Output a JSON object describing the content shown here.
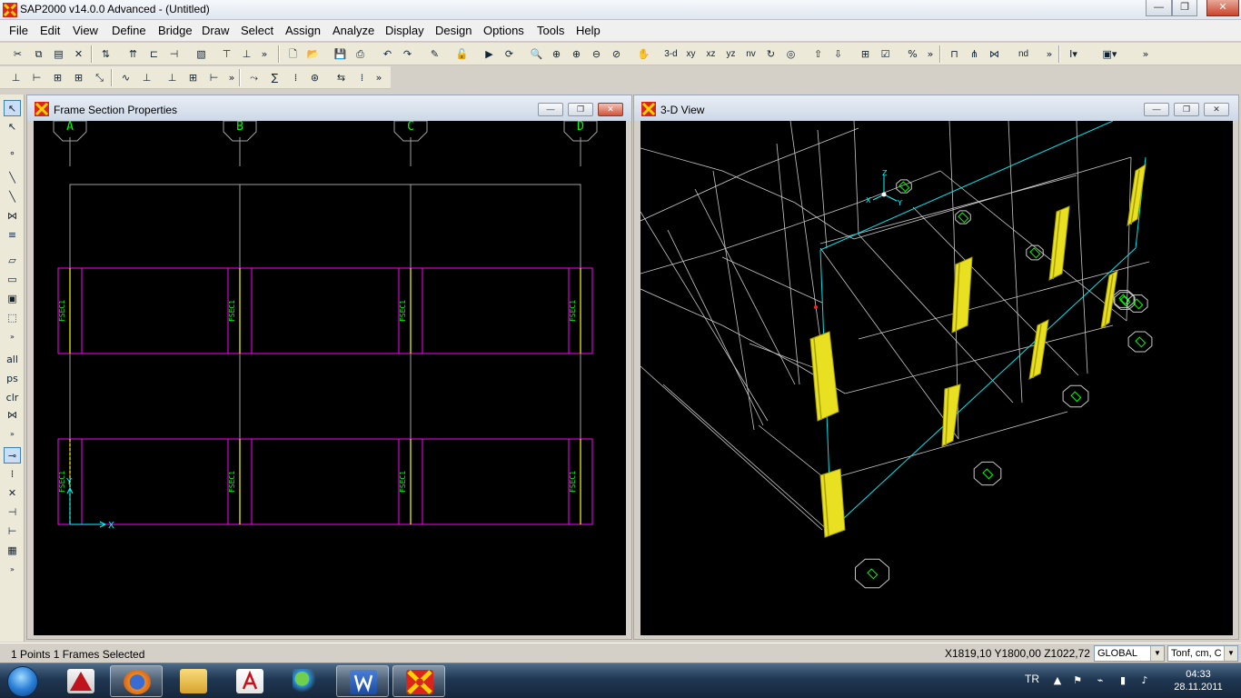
{
  "app": {
    "title": "SAP2000 v14.0.0 Advanced  - (Untitled)"
  },
  "window_controls": {
    "minimize": "—",
    "maximize": "❐",
    "close": "✕"
  },
  "menu": [
    "File",
    "Edit",
    "View",
    "Define",
    "Bridge",
    "Draw",
    "Select",
    "Assign",
    "Analyze",
    "Display",
    "Design",
    "Options",
    "Tools",
    "Help"
  ],
  "toolbar1": {
    "view_3d": "3-d",
    "view_xy": "xy",
    "view_xz": "xz",
    "view_yz": "yz",
    "view_nv": "nv",
    "nd_label": "nd"
  },
  "left_toolbar": {
    "all": "all",
    "ps": "ps",
    "clr": "clr"
  },
  "windows": {
    "frame_section": {
      "title": "Frame Section Properties"
    },
    "view_3d": {
      "title": "3-D View"
    }
  },
  "plan": {
    "grid_labels": [
      "A",
      "B",
      "C",
      "D"
    ],
    "section_label": "FSEC1",
    "axis_x": "X",
    "axis_y": "Y",
    "colors": {
      "grid": "#a0a0a0",
      "frame": "#ff00ff",
      "section": "#00ff00",
      "column": "#ffff00",
      "axis": "#00ffff"
    }
  },
  "view3d": {
    "axis_x": "X",
    "axis_y": "Y",
    "axis_z": "Z",
    "colors": {
      "grid": "#c8c8c8",
      "highlight": "#00e5ee",
      "column_fill": "#e8e020",
      "column_edge": "#a8a000",
      "restraint": "#00ff00",
      "point": "#ff2020"
    }
  },
  "status": {
    "selection": "1 Points  1 Frames Selected",
    "coords": "X1819,10  Y1800,00  Z1022,72",
    "coord_system": "GLOBAL",
    "units": "Tonf, cm, C"
  },
  "taskbar": {
    "apps": [
      "autocad-icon",
      "firefox-icon",
      "explorer-icon",
      "acrobat-icon",
      "messenger-icon",
      "word-icon",
      "sap2000-icon"
    ],
    "lang": "TR",
    "time": "04:33",
    "date": "28.11.2011"
  }
}
